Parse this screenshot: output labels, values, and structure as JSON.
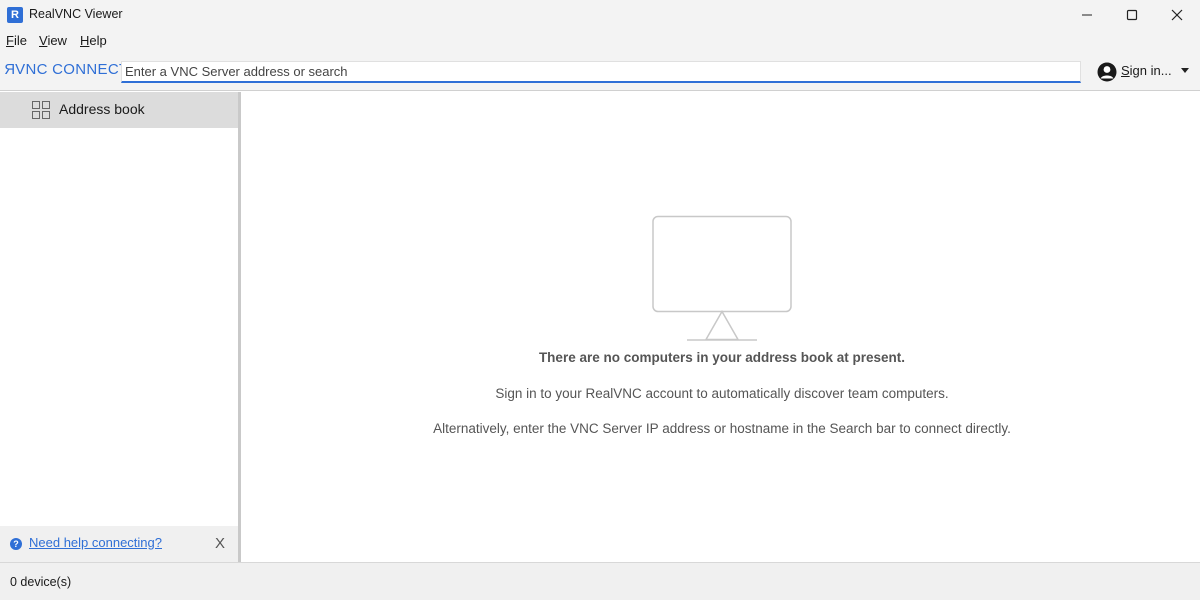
{
  "window": {
    "title": "RealVNC Viewer",
    "icon": "realvnc-app-icon",
    "icon_glyph": "R",
    "accent_color": "#2f6fd6"
  },
  "menu": {
    "file": {
      "key": "F",
      "rest": "ile"
    },
    "view": {
      "key": "V",
      "rest": "iew"
    },
    "help": {
      "key": "H",
      "rest": "elp"
    }
  },
  "toolbar": {
    "logo_first": "R",
    "logo_rest": "VNC CONNECT",
    "search_placeholder": "Enter a VNC Server address or search",
    "signin_key": "S",
    "signin_rest": "ign in..."
  },
  "sidebar": {
    "items": [
      {
        "label": "Address book",
        "icon": "grid-icon",
        "selected": true
      }
    ],
    "help_link": "Need help connecting?",
    "help_icon": "question-icon",
    "help_icon_glyph": "?",
    "help_close": "X"
  },
  "main": {
    "empty_title": "There are no computers in your address book at present.",
    "empty_line1": "Sign in to your RealVNC account to automatically discover team computers.",
    "empty_line2": "Alternatively, enter the VNC Server IP address or hostname in the Search bar to connect directly."
  },
  "status": {
    "device_count": "0 device(s)"
  }
}
